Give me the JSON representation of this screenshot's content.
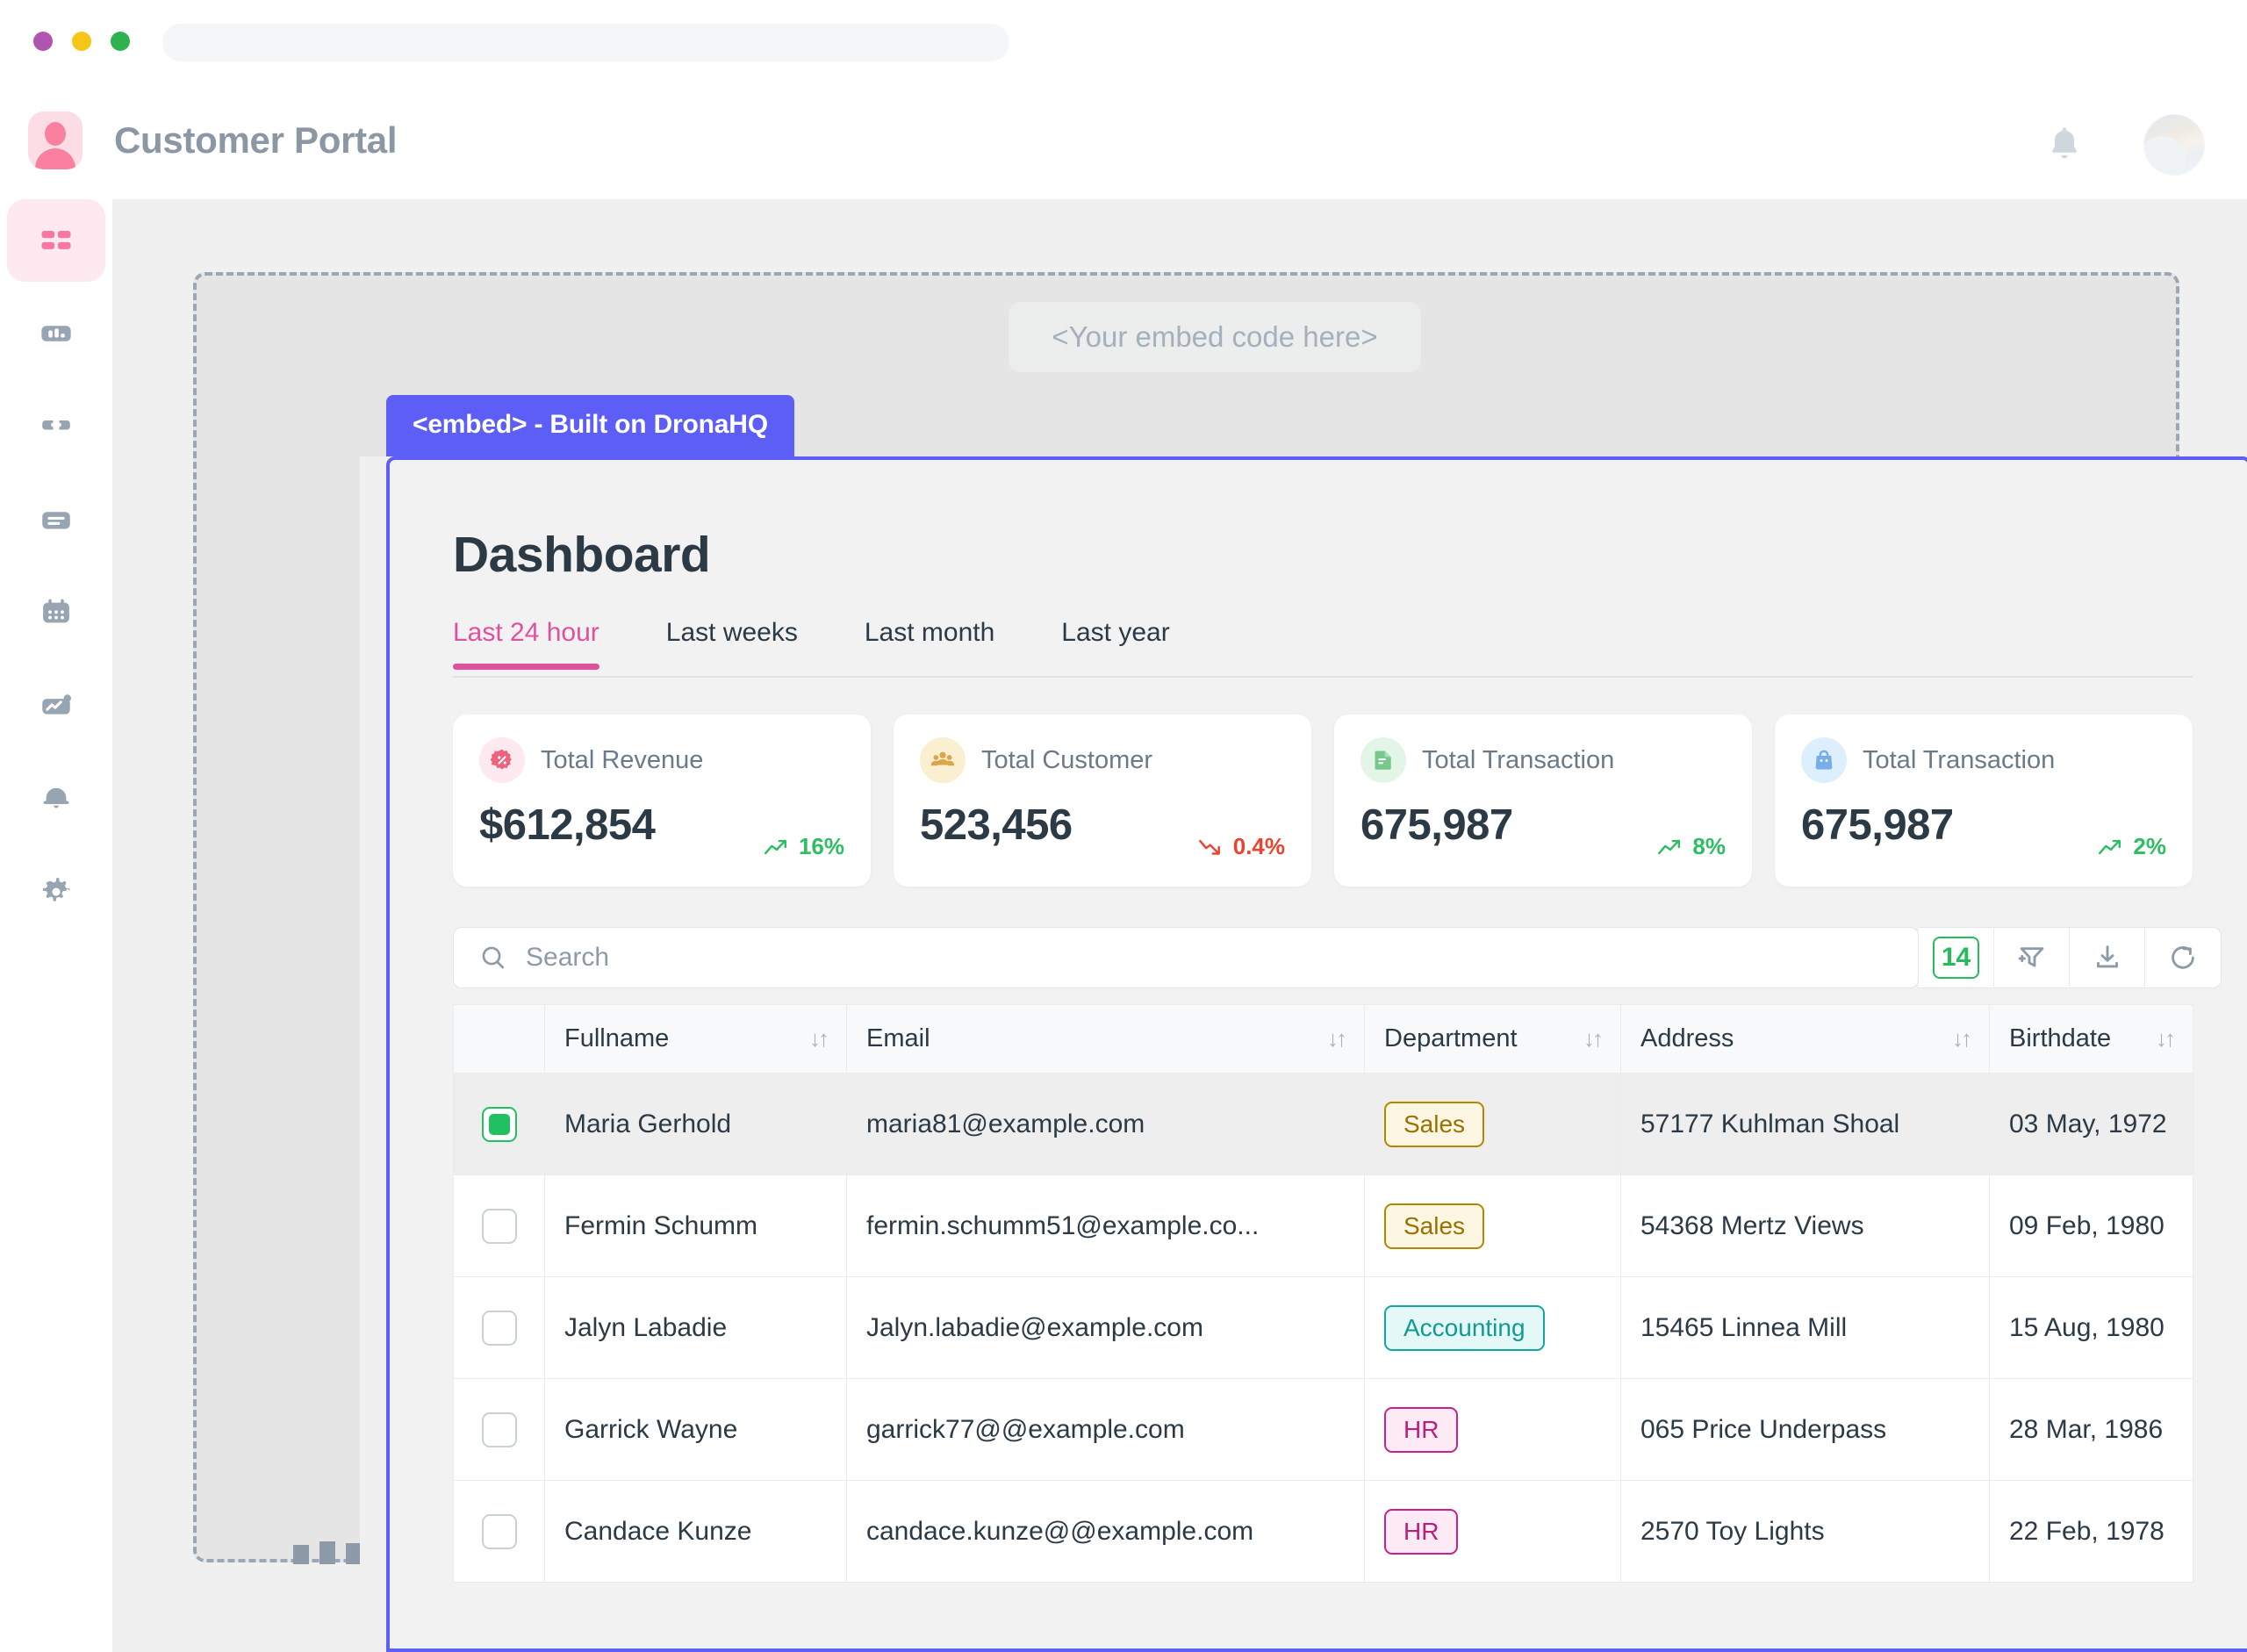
{
  "browser": {
    "dots": [
      "close-dot",
      "minimize-dot",
      "maximize-dot"
    ],
    "url_value": "",
    "url_placeholder": ""
  },
  "app_header": {
    "title": "Customer Portal",
    "notification_icon": "bell-icon",
    "avatar_icon": "user-avatar"
  },
  "sidebar": {
    "items": [
      {
        "icon": "dashboard-grid-icon",
        "active": true
      },
      {
        "icon": "bar-chart-icon",
        "active": false
      },
      {
        "icon": "puzzle-icon",
        "active": false
      },
      {
        "icon": "document-icon",
        "active": false
      },
      {
        "icon": "calendar-icon",
        "active": false
      },
      {
        "icon": "analytics-icon",
        "active": false
      },
      {
        "icon": "bell-icon",
        "active": false
      },
      {
        "icon": "gear-icon",
        "active": false
      }
    ]
  },
  "embed_area": {
    "placeholder_text": "<Your embed code here>",
    "tab_label": "<embed> - Built on DronaHQ",
    "accent_color": "#5c5ef5"
  },
  "dashboard": {
    "title": "Dashboard",
    "tabs": [
      {
        "label": "Last 24 hour",
        "active": true
      },
      {
        "label": "Last weeks",
        "active": false
      },
      {
        "label": "Last month",
        "active": false
      },
      {
        "label": "Last year",
        "active": false
      }
    ],
    "active_tab_color": "#e0519c",
    "cards": [
      {
        "label": "Total Revenue",
        "value": "$612,854",
        "delta": "16%",
        "direction": "up",
        "icon": "discount-badge-icon",
        "icon_bg": "#fde9ef",
        "icon_color": "#f0617f"
      },
      {
        "label": "Total Customer",
        "value": "523,456",
        "delta": "0.4%",
        "direction": "down",
        "icon": "users-group-icon",
        "icon_bg": "#fbefd2",
        "icon_color": "#dba54a"
      },
      {
        "label": "Total Transaction",
        "value": "675,987",
        "delta": "8%",
        "direction": "up",
        "icon": "file-text-icon",
        "icon_bg": "#e2f5e6",
        "icon_color": "#75c98a"
      },
      {
        "label": "Total Transaction",
        "value": "675,987",
        "delta": "2%",
        "direction": "up",
        "icon": "shopping-bag-icon",
        "icon_bg": "#ddeefc",
        "icon_color": "#76aeea"
      }
    ],
    "toolbar": {
      "search_value": "",
      "search_placeholder": "Search",
      "search_icon": "search-icon",
      "record_count": "14",
      "record_count_color": "#27bb5e",
      "filter_icon": "add-filter-icon",
      "download_icon": "download-icon",
      "refresh_icon": "refresh-icon"
    },
    "table": {
      "columns": [
        {
          "key": "check",
          "label": "",
          "sortable": false
        },
        {
          "key": "fullname",
          "label": "Fullname",
          "sortable": true
        },
        {
          "key": "email",
          "label": "Email",
          "sortable": true
        },
        {
          "key": "department",
          "label": "Department",
          "sortable": true
        },
        {
          "key": "address",
          "label": "Address",
          "sortable": true
        },
        {
          "key": "birthdate",
          "label": "Birthdate",
          "sortable": true
        }
      ],
      "sort_icon": "sort-updown-icon",
      "rows": [
        {
          "selected": true,
          "fullname": "Maria Gerhold",
          "email": "maria81@example.com",
          "department": "Sales",
          "department_style": "sales",
          "address": "57177 Kuhlman Shoal",
          "birthdate": "03 May, 1972"
        },
        {
          "selected": false,
          "fullname": "Fermin Schumm",
          "email": "fermin.schumm51@example.co...",
          "department": "Sales",
          "department_style": "sales",
          "address": "54368 Mertz Views",
          "birthdate": "09 Feb, 1980"
        },
        {
          "selected": false,
          "fullname": "Jalyn Labadie",
          "email": "Jalyn.labadie@example.com",
          "department": "Accounting",
          "department_style": "accounting",
          "address": "15465 Linnea Mill",
          "birthdate": "15 Aug, 1980"
        },
        {
          "selected": false,
          "fullname": "Garrick Wayne",
          "email": "garrick77@@example.com",
          "department": "HR",
          "department_style": "hr",
          "address": "065 Price Underpass",
          "birthdate": "28 Mar, 1986"
        },
        {
          "selected": false,
          "fullname": "Candace Kunze",
          "email": "candace.kunze@@example.com",
          "department": "HR",
          "department_style": "hr",
          "address": "2570 Toy Lights",
          "birthdate": "22 Feb, 1978"
        }
      ]
    }
  }
}
